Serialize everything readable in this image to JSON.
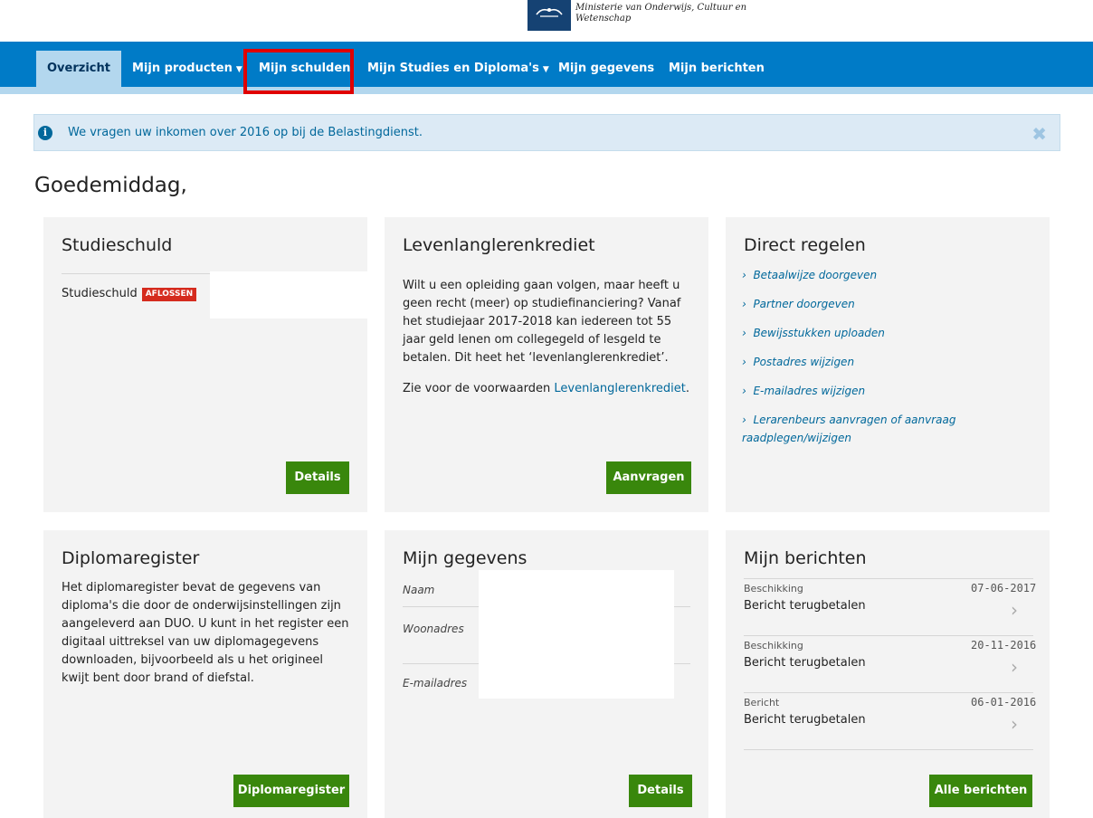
{
  "header": {
    "ministry_line1": "Ministerie van Onderwijs, Cultuur en",
    "ministry_line2": "Wetenschap"
  },
  "nav": {
    "items": [
      {
        "label": "Overzicht"
      },
      {
        "label": "Mijn producten"
      },
      {
        "label": "Mijn schulden"
      },
      {
        "label": "Mijn Studies en Diploma's"
      },
      {
        "label": "Mijn gegevens"
      },
      {
        "label": "Mijn berichten"
      }
    ]
  },
  "alert": {
    "text": "We vragen uw inkomen over 2016 op bij de Belastingdienst."
  },
  "greeting": "Goedemiddag,",
  "studieschuld": {
    "title": "Studieschuld",
    "row_label": "Studieschuld",
    "badge": "AFLOSSEN",
    "button": "Details"
  },
  "levenlang": {
    "title": "Levenlanglerenkrediet",
    "paragraph": "Wilt u een opleiding gaan volgen, maar heeft u geen recht (meer) op studiefinanciering? Vanaf het studiejaar 2017-2018 kan iedereen tot 55 jaar geld lenen om collegegeld of lesgeld te betalen. Dit heet het ‘levenlanglerenkrediet’.",
    "conditions_prefix": "Zie voor de voorwaarden",
    "conditions_link": "Levenlanglerenkrediet",
    "conditions_suffix": ".",
    "button": "Aanvragen"
  },
  "direct": {
    "title": "Direct regelen",
    "links": [
      {
        "label": "Betaalwijze doorgeven"
      },
      {
        "label": "Partner doorgeven"
      },
      {
        "label": "Bewijsstukken uploaden"
      },
      {
        "label": "Postadres wijzigen"
      },
      {
        "label": "E-mailadres wijzigen"
      },
      {
        "label": "Lerarenbeurs aanvragen of aanvraag raadplegen/wijzigen"
      }
    ]
  },
  "diploma": {
    "title": "Diplomaregister",
    "paragraph": "Het diplomaregister bevat de gegevens van diploma's die door de onderwijsinstellingen zijn aangeleverd aan DUO. U kunt in het register een digitaal uittreksel van uw diplomagegevens downloaden, bijvoorbeeld als u het origineel kwijt bent door brand of diefstal.",
    "button": "Diplomaregister"
  },
  "gegevens": {
    "title": "Mijn gegevens",
    "fields": [
      {
        "label": "Naam"
      },
      {
        "label": "Woonadres"
      },
      {
        "label": "E-mailadres"
      }
    ],
    "button": "Details"
  },
  "berichten": {
    "title": "Mijn berichten",
    "messages": [
      {
        "type": "Beschikking",
        "date": "07-06-2017",
        "title": "Bericht terugbetalen"
      },
      {
        "type": "Beschikking",
        "date": "20-11-2016",
        "title": "Bericht terugbetalen"
      },
      {
        "type": "Bericht",
        "date": "06-01-2016",
        "title": "Bericht terugbetalen"
      }
    ],
    "button": "Alle berichten"
  },
  "colors": {
    "nav_blue": "#007bc7",
    "nav_light": "#b3d7ee",
    "button_green": "#39870c",
    "badge_red": "#d52b1e",
    "link_blue": "#01689b",
    "highlight_red": "#e00000"
  }
}
